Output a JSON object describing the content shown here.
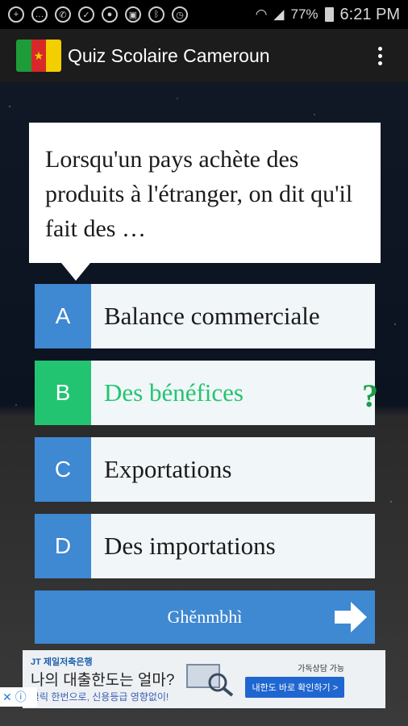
{
  "status_bar": {
    "battery": "77%",
    "time": "6:21 PM",
    "icons": [
      "plus-icon",
      "message-icon",
      "whatsapp-icon",
      "chat-icon",
      "location-icon",
      "lock-icon",
      "bluetooth-icon",
      "alarm-icon",
      "wifi-icon",
      "signal-icon",
      "battery-icon"
    ]
  },
  "app_bar": {
    "title": "Quiz Scolaire Cameroun",
    "logo_icon": "cameroon-flag-icon",
    "menu_icon": "overflow-menu-icon"
  },
  "question": {
    "text": "Lorsqu'un pays achète des produits à l'étranger, on dit qu'il fait des …"
  },
  "answers": [
    {
      "letter": "A",
      "text": "Balance commerciale"
    },
    {
      "letter": "B",
      "text": "Des bénéfices",
      "selected": true
    },
    {
      "letter": "C",
      "text": "Exportations"
    },
    {
      "letter": "D",
      "text": "Des importations"
    }
  ],
  "selected_marker": "?",
  "next_button": {
    "label": "Ghěnmbhì",
    "icon": "right-arrow-icon"
  },
  "ad": {
    "brand": "JT 제일저축은행",
    "headline": "나의 대출한도는 얼마?",
    "subline": "클릭 한번으로, 신용등급 영향없이!",
    "cta": "내한도 바로 확인하기 >",
    "tag": "가독상담 가능"
  },
  "colors": {
    "accent_blue": "#3f88d2",
    "selected_green": "#23c471",
    "qmark_green": "#1a9e48"
  }
}
